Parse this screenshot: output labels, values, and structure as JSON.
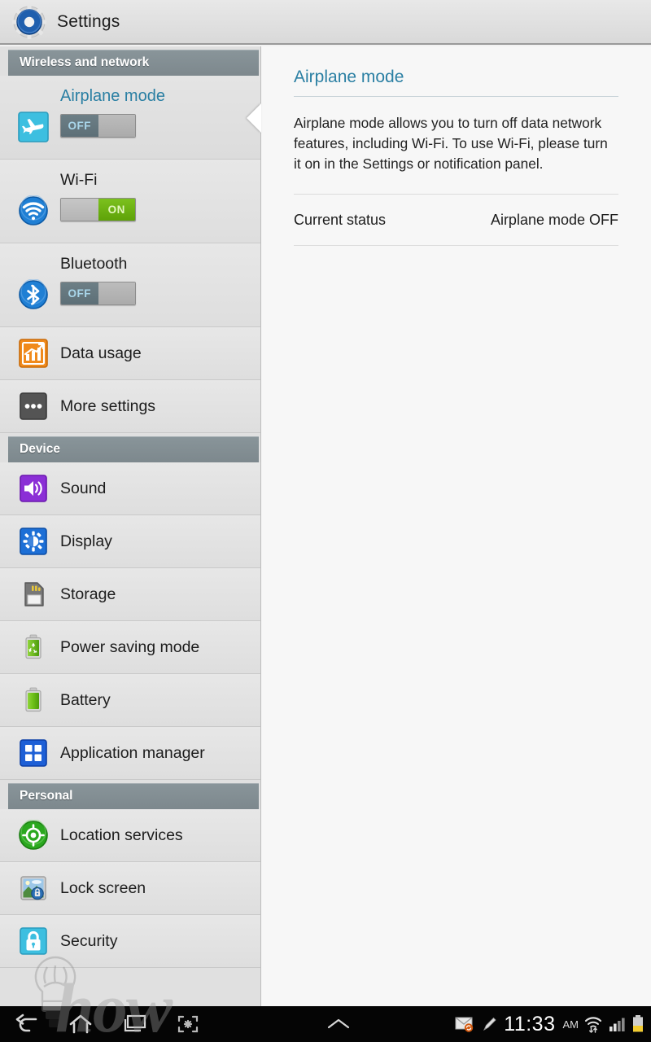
{
  "titlebar": {
    "app_title": "Settings",
    "icon": "settings-gear-icon"
  },
  "sidebar": {
    "sections": [
      {
        "header": "Wireless and network",
        "items": [
          {
            "label": "Airplane mode",
            "icon": "airplane-icon",
            "toggle": "OFF",
            "selected": true
          },
          {
            "label": "Wi-Fi",
            "icon": "wifi-icon",
            "toggle": "ON",
            "selected": false
          },
          {
            "label": "Bluetooth",
            "icon": "bluetooth-icon",
            "toggle": "OFF",
            "selected": false
          },
          {
            "label": "Data usage",
            "icon": "data-usage-chart-icon",
            "toggle": null,
            "selected": false
          },
          {
            "label": "More settings",
            "icon": "more-settings-dots-icon",
            "toggle": null,
            "selected": false
          }
        ]
      },
      {
        "header": "Device",
        "items": [
          {
            "label": "Sound",
            "icon": "speaker-icon",
            "toggle": null,
            "selected": false
          },
          {
            "label": "Display",
            "icon": "brightness-icon",
            "toggle": null,
            "selected": false
          },
          {
            "label": "Storage",
            "icon": "sd-card-icon",
            "toggle": null,
            "selected": false
          },
          {
            "label": "Power saving mode",
            "icon": "battery-recycle-icon",
            "toggle": null,
            "selected": false
          },
          {
            "label": "Battery",
            "icon": "battery-icon",
            "toggle": null,
            "selected": false
          },
          {
            "label": "Application manager",
            "icon": "app-grid-icon",
            "toggle": null,
            "selected": false
          }
        ]
      },
      {
        "header": "Personal",
        "items": [
          {
            "label": "Location services",
            "icon": "location-target-icon",
            "toggle": null,
            "selected": false
          },
          {
            "label": "Lock screen",
            "icon": "lock-screen-photo-icon",
            "toggle": null,
            "selected": false
          },
          {
            "label": "Security",
            "icon": "padlock-icon",
            "toggle": null,
            "selected": false
          }
        ]
      }
    ]
  },
  "detail": {
    "title": "Airplane mode",
    "description": "Airplane mode allows you to turn off data network features, including Wi-Fi. To use Wi-Fi, please turn it on in the Settings or notification panel.",
    "status_label": "Current status",
    "status_value": "Airplane mode OFF"
  },
  "watermark": {
    "text": "how",
    "icon": "lightbulb-icon"
  },
  "navbar": {
    "buttons": [
      {
        "name": "back-button",
        "icon": "back-arrow-icon"
      },
      {
        "name": "home-button",
        "icon": "home-icon"
      },
      {
        "name": "recents-button",
        "icon": "recent-apps-icon"
      },
      {
        "name": "screenshot-button",
        "icon": "screen-capture-icon"
      },
      {
        "name": "expand-button",
        "icon": "chevron-up-icon"
      }
    ],
    "status": {
      "email_icon": "email-sync-icon",
      "pencil_icon": "pencil-icon",
      "time": "11:33",
      "ampm": "AM",
      "wifi_icon": "wifi-transfer-icon",
      "signal_icon": "cellular-signal-icon",
      "battery_icon": "battery-status-icon"
    }
  },
  "colors": {
    "accent_teal": "#2a7fa3",
    "section_header": "#7d888d",
    "toggle_on_green": "#6fb514",
    "sidebar_bg": "#e0e0e0",
    "detail_bg": "#f7f7f7"
  }
}
